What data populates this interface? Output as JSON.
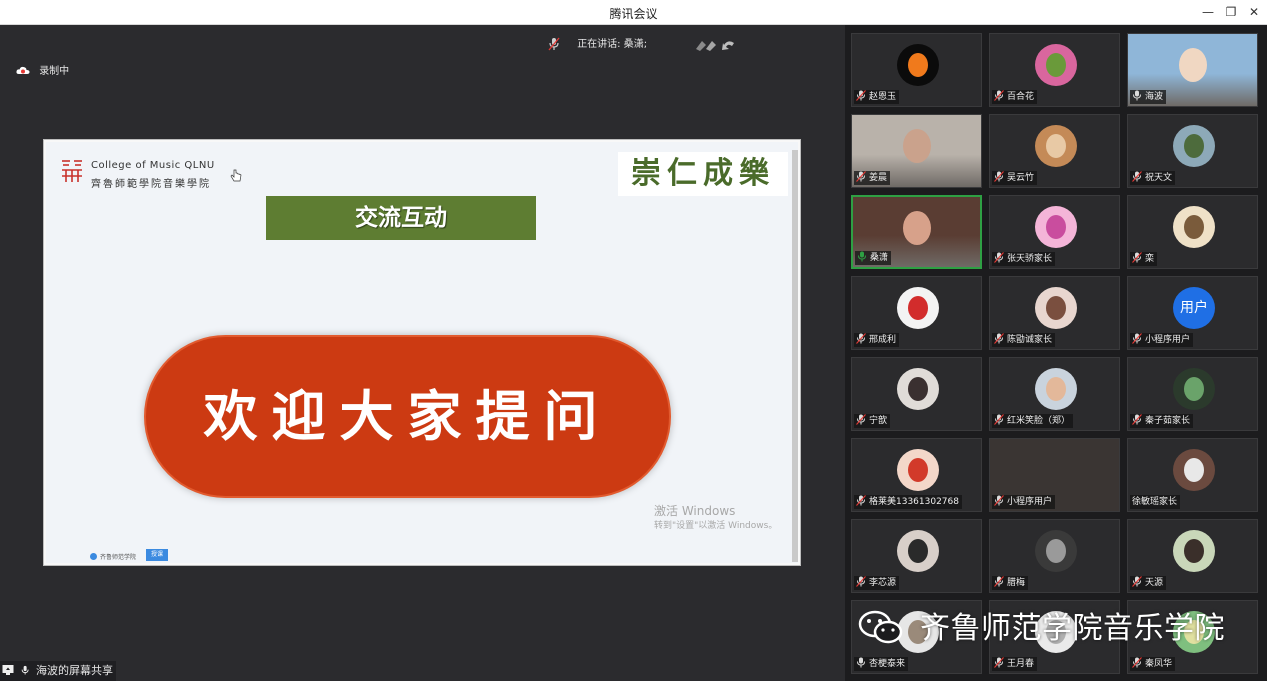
{
  "window": {
    "title": "腾讯会议",
    "minimize": "—",
    "restore": "❐",
    "close": "✕"
  },
  "speaking": {
    "label": "正在讲话: 桑潇;"
  },
  "recording": {
    "label": "录制中"
  },
  "slide": {
    "college_en": "College of Music QLNU",
    "college_cn": "齊魯師範學院音樂學院",
    "motto": "崇仁成樂",
    "section_title": "交流互动",
    "welcome": "欢迎大家提问",
    "activate_title": "激活 Windows",
    "activate_sub": "转到\"设置\"以激活 Windows。",
    "taskbar_text": "齐鲁师范学院",
    "taskbar_btn": "授课"
  },
  "share_bar": {
    "label": "海波的屏幕共享"
  },
  "participants": [
    {
      "name": "赵恩玉",
      "avatar_color": "#0b0b0b",
      "accent": "#f07a1c"
    },
    {
      "name": "百合花",
      "avatar_color": "#d9669e",
      "accent": "#6a9a3a"
    },
    {
      "name": "海波",
      "avatar_color": "#8fb6d8",
      "accent": "#f0d7c2"
    },
    {
      "name": "姜晨",
      "avatar_color": "#b9b2aa",
      "accent": "#caa28c"
    },
    {
      "name": "吴云竹",
      "avatar_color": "#c48a57",
      "accent": "#e8c9a5"
    },
    {
      "name": "祝天文",
      "avatar_color": "#8da9b8",
      "accent": "#4d6b3c"
    },
    {
      "name": "桑潇",
      "avatar_color": "#5a3d33",
      "accent": "#d7a18a"
    },
    {
      "name": "张天骄家长",
      "avatar_color": "#f4b5d8",
      "accent": "#c94d9e"
    },
    {
      "name": "栾",
      "avatar_color": "#efe1c7",
      "accent": "#7a5b3b"
    },
    {
      "name": "邢成利",
      "avatar_color": "#f3f3f3",
      "accent": "#d22c2c"
    },
    {
      "name": "陈勖诚家长",
      "avatar_color": "#e8d6cf",
      "accent": "#7a4f3f"
    },
    {
      "name": "小程序用户",
      "avatar_color": "#1f6fe5",
      "accent": "#ffffff",
      "avatar_text": "用户"
    },
    {
      "name": "宁歆",
      "avatar_color": "#e0dcd8",
      "accent": "#3a3030"
    },
    {
      "name": "红米笑脸（郑）",
      "avatar_color": "#c9d3dd",
      "accent": "#e3b89a"
    },
    {
      "name": "秦子茹家长",
      "avatar_color": "#2b3a2c",
      "accent": "#6aa36a"
    },
    {
      "name": "格莱美13361302768",
      "avatar_color": "#f3d7c9",
      "accent": "#d23a2a"
    },
    {
      "name": "小程序用户",
      "avatar_color": "",
      "accent": ""
    },
    {
      "name": "徐敏瑶家长",
      "avatar_color": "#6b4a3f",
      "accent": "#e8e8e8"
    },
    {
      "name": "李芯源",
      "avatar_color": "#d8cfc9",
      "accent": "#2a2a2a"
    },
    {
      "name": "腊梅",
      "avatar_color": "#3a3a3a",
      "accent": "#9a9a9a"
    },
    {
      "name": "天源",
      "avatar_color": "#c9d7b9",
      "accent": "#3a2f2a"
    },
    {
      "name": "杏梗泰来",
      "avatar_color": "#e6e6e6",
      "accent": "#9a8a7a"
    },
    {
      "name": "王月春",
      "avatar_color": "#eaeaea",
      "accent": "#b0b0b0"
    },
    {
      "name": "秦凤华",
      "avatar_color": "#7fbf7f",
      "accent": "#e0e0a0"
    }
  ],
  "watermark": {
    "text": "齐鲁师范学院音乐学院"
  },
  "colors": {
    "main_bg": "#2b2b2e",
    "exchange_bg": "#5e7d32",
    "welcome_bg": "#cc3a12",
    "speaking_green": "#2ea043"
  }
}
